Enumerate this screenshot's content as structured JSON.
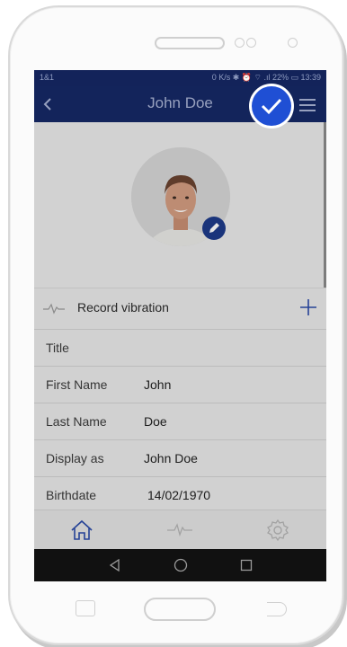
{
  "status_bar": {
    "carrier": "1&1",
    "indicators": "0 K/s ✱ ⏰ ⌔ .ıl 22% ▭ 13:39"
  },
  "app_bar": {
    "title": "John Doe",
    "back_icon": "chevron-left-icon",
    "confirm_icon": "check-icon",
    "menu_icon": "hamburger-menu-icon"
  },
  "profile": {
    "avatar_icon": "person-photo",
    "edit_icon": "pencil-icon"
  },
  "record": {
    "label": "Record vibration",
    "add_icon": "plus-icon",
    "wave_icon": "vibration-wave-icon"
  },
  "fields": [
    {
      "label": "Title",
      "value": ""
    },
    {
      "label": "First Name",
      "value": "John"
    },
    {
      "label": "Last Name",
      "value": "Doe"
    },
    {
      "label": "Display as",
      "value": "John Doe"
    },
    {
      "label": "Birthdate",
      "value": "14/02/1970"
    }
  ],
  "bottom_nav": {
    "items": [
      "home-icon",
      "vibration-wave-icon",
      "settings-gear-icon"
    ]
  },
  "system_nav": {
    "items": [
      "back-triangle-icon",
      "home-circle-icon",
      "recents-square-icon"
    ]
  },
  "colors": {
    "accent": "#1f4fd4",
    "appbar": "#162966",
    "nav_icon": "#2a4aa8"
  }
}
